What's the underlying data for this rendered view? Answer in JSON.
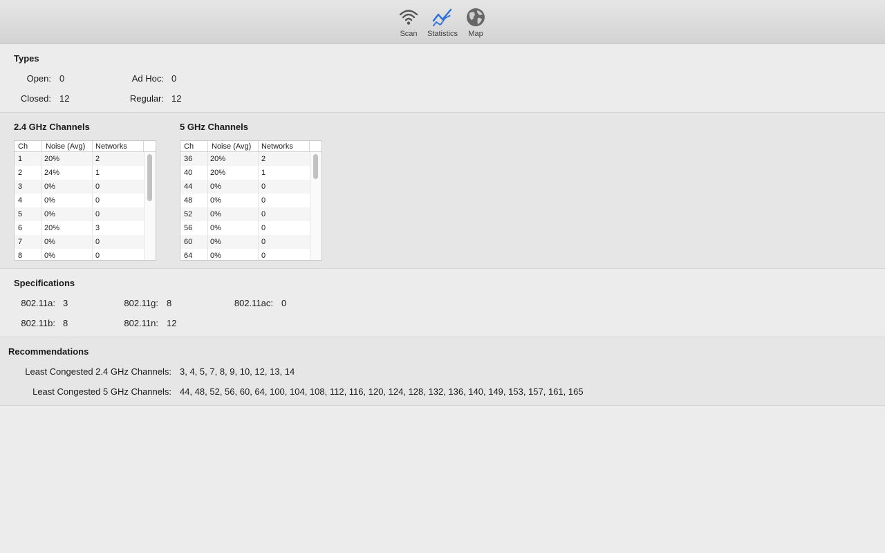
{
  "toolbar": {
    "items": [
      {
        "label": "Scan",
        "icon": "wifi-icon"
      },
      {
        "label": "Statistics",
        "icon": "chart-line-icon",
        "selected": true
      },
      {
        "label": "Map",
        "icon": "globe-icon"
      }
    ],
    "accent": "#2c6fd8"
  },
  "types": {
    "title": "Types",
    "open_label": "Open:",
    "open_value": "0",
    "closed_label": "Closed:",
    "closed_value": "12",
    "adhoc_label": "Ad Hoc:",
    "adhoc_value": "0",
    "regular_label": "Regular:",
    "regular_value": "12"
  },
  "channels24": {
    "title": "2.4 GHz Channels",
    "headers": [
      "Ch",
      "Noise (Avg)",
      "Networks"
    ],
    "rows": [
      [
        "1",
        "20%",
        "2"
      ],
      [
        "2",
        "24%",
        "1"
      ],
      [
        "3",
        "0%",
        "0"
      ],
      [
        "4",
        "0%",
        "0"
      ],
      [
        "5",
        "0%",
        "0"
      ],
      [
        "6",
        "20%",
        "3"
      ],
      [
        "7",
        "0%",
        "0"
      ],
      [
        "8",
        "0%",
        "0"
      ]
    ]
  },
  "channels5": {
    "title": "5 GHz Channels",
    "headers": [
      "Ch",
      "Noise (Avg)",
      "Networks"
    ],
    "rows": [
      [
        "36",
        "20%",
        "2"
      ],
      [
        "40",
        "20%",
        "1"
      ],
      [
        "44",
        "0%",
        "0"
      ],
      [
        "48",
        "0%",
        "0"
      ],
      [
        "52",
        "0%",
        "0"
      ],
      [
        "56",
        "0%",
        "0"
      ],
      [
        "60",
        "0%",
        "0"
      ],
      [
        "64",
        "0%",
        "0"
      ]
    ]
  },
  "specs": {
    "title": "Specifications",
    "a_label": "802.11a:",
    "a_value": "3",
    "b_label": "802.11b:",
    "b_value": "8",
    "g_label": "802.11g:",
    "g_value": "8",
    "n_label": "802.11n:",
    "n_value": "12",
    "ac_label": "802.11ac:",
    "ac_value": "0"
  },
  "recommendations": {
    "title": "Recommendations",
    "ch24_label": "Least Congested 2.4 GHz Channels:",
    "ch24_value": "3, 4, 5, 7, 8, 9, 10, 12, 13, 14",
    "ch5_label": "Least Congested 5 GHz Channels:",
    "ch5_value": "44, 48, 52, 56, 60, 64, 100, 104, 108, 112, 116, 120, 124, 128, 132, 136, 140, 149, 153, 157, 161, 165"
  }
}
